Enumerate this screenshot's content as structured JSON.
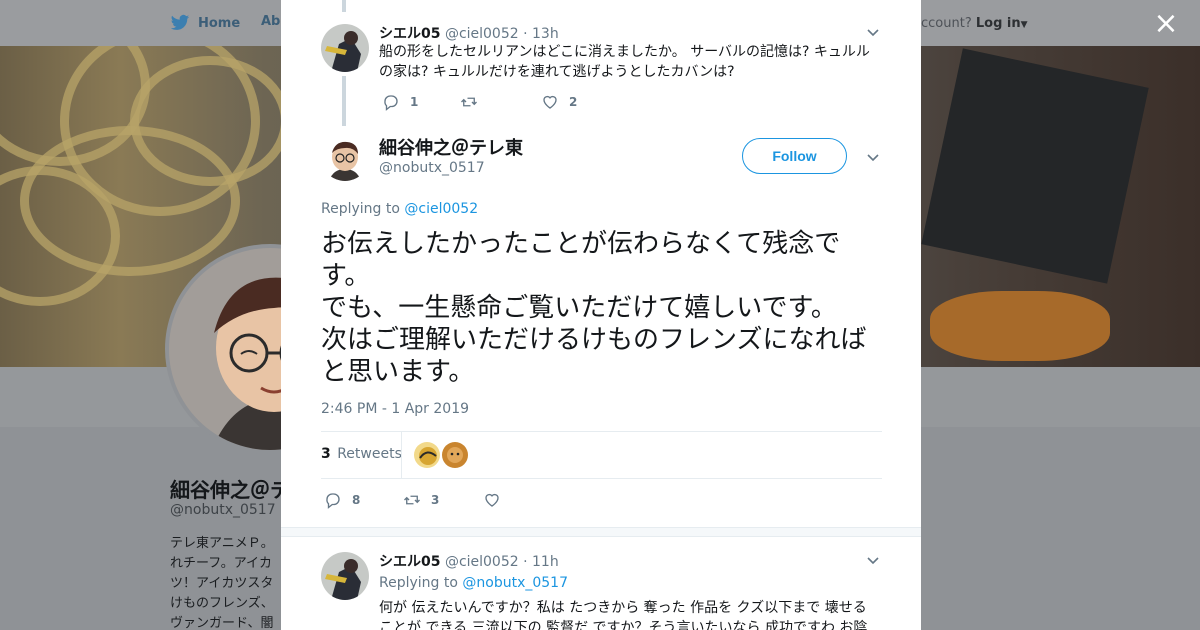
{
  "background": {
    "nav": {
      "home": "Home",
      "about": "Abo"
    },
    "login": {
      "prefix": "ccount?",
      "link": "Log in"
    },
    "profile": {
      "name": "細谷伸之＠テ",
      "handle": "@nobutx_0517",
      "bio": [
        "テレ東アニメＰ。",
        "れチーフ。アイカ",
        "ツ！アイカツスタ",
        "けものフレンズ、",
        "ヴァンガード、闇"
      ]
    }
  },
  "modal": {
    "close_label": "×",
    "previous_tweet": {
      "name": "シエル05",
      "handle": "@ciel0052",
      "time": "· 13h",
      "text": "船の形をしたセルリアンはどこに消えましたか。 サーバルの記憶は? キュルルの家は? キュルルだけを連れて逃げようとしたカバンは?",
      "replies": "1",
      "retweets": "",
      "likes": "2"
    },
    "main_tweet": {
      "name": "細谷伸之＠テレ東",
      "handle": "@nobutx_0517",
      "follow_label": "Follow",
      "replying_prefix": "Replying to",
      "replying_to": "@ciel0052",
      "lines": [
        "お伝えしたかったことが伝わらなくて残念です。",
        "でも、一生懸命ご覧いただけて嬉しいです。",
        "次はご理解いただけるけものフレンズになればと思います。"
      ],
      "timestamp": "2:46 PM - 1 Apr 2019",
      "retweet_count": "3",
      "retweet_label": "Retweets",
      "replies": "8",
      "retweets": "3",
      "likes": ""
    },
    "reply_tweet": {
      "name": "シエル05",
      "handle": "@ciel0052",
      "time": "· 11h",
      "replying_prefix": "Replying to",
      "replying_to": "@nobutx_0517",
      "text": "何が 伝えたいんですか？私は たつきから 奪った 作品を クズ以下まで 壊せることが できる 三流以下の 監督だ ですか？そう言いたいなら 成功ですわ お陰"
    }
  },
  "colors": {
    "link": "#1b95e0",
    "muted": "#657786",
    "text": "#14171a",
    "border": "#e6ecf0"
  }
}
